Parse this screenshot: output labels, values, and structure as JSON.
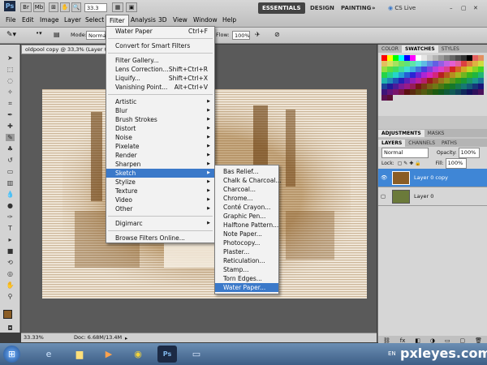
{
  "app": {
    "logo": "Ps",
    "menu": [
      "File",
      "Edit",
      "Image",
      "Layer",
      "Select",
      "Filter",
      "Analysis",
      "3D",
      "View",
      "Window",
      "Help"
    ],
    "active_menu": "Filter",
    "zoom_field": "33.3",
    "workspaces": [
      "ESSENTIALS",
      "DESIGN",
      "PAINTING"
    ],
    "more_workspaces": "»",
    "cs_live": "CS Live",
    "window_controls": [
      "–",
      "▢",
      "✕"
    ]
  },
  "options": {
    "mode_label": "Mode:",
    "mode_value": "Normal",
    "flow_label": "Flow:",
    "flow_value": "100%",
    "opacity_value": "100%"
  },
  "document": {
    "tab_title": "oldpool copy @ 33,3% (Layer 0 c",
    "status_zoom": "33.33%",
    "status_doc": "Doc: 6.68M/13.4M"
  },
  "filter_menu": {
    "items": [
      {
        "label": "Water Paper",
        "shortcut": "Ctrl+F"
      },
      {
        "sep": true
      },
      {
        "label": "Convert for Smart Filters"
      },
      {
        "sep": true
      },
      {
        "label": "Filter Gallery..."
      },
      {
        "label": "Lens Correction...",
        "shortcut": "Shift+Ctrl+R"
      },
      {
        "label": "Liquify...",
        "shortcut": "Shift+Ctrl+X"
      },
      {
        "label": "Vanishing Point...",
        "shortcut": "Alt+Ctrl+V"
      },
      {
        "sep": true
      },
      {
        "label": "Artistic",
        "sub": true
      },
      {
        "label": "Blur",
        "sub": true
      },
      {
        "label": "Brush Strokes",
        "sub": true
      },
      {
        "label": "Distort",
        "sub": true
      },
      {
        "label": "Noise",
        "sub": true
      },
      {
        "label": "Pixelate",
        "sub": true
      },
      {
        "label": "Render",
        "sub": true
      },
      {
        "label": "Sharpen",
        "sub": true
      },
      {
        "label": "Sketch",
        "sub": true,
        "highlight": true
      },
      {
        "label": "Stylize",
        "sub": true
      },
      {
        "label": "Texture",
        "sub": true
      },
      {
        "label": "Video",
        "sub": true
      },
      {
        "label": "Other",
        "sub": true
      },
      {
        "sep": true
      },
      {
        "label": "Digimarc",
        "sub": true
      },
      {
        "sep": true
      },
      {
        "label": "Browse Filters Online..."
      }
    ]
  },
  "sketch_menu": {
    "items": [
      "Bas Relief...",
      "Chalk & Charcoal...",
      "Charcoal...",
      "Chrome...",
      "Conté Crayon...",
      "Graphic Pen...",
      "Halftone Pattern...",
      "Note Paper...",
      "Photocopy...",
      "Plaster...",
      "Reticulation...",
      "Stamp...",
      "Torn Edges...",
      "Water Paper..."
    ],
    "highlight_index": 13
  },
  "panels": {
    "color_tabs": [
      "COLOR",
      "SWATCHES",
      "STYLES"
    ],
    "adj_tabs": [
      "ADJUSTMENTS",
      "MASKS"
    ],
    "layer_tabs": [
      "LAYERS",
      "CHANNELS",
      "PATHS"
    ],
    "blend_mode": "Normal",
    "opacity_label": "Opacity:",
    "opacity_value": "100%",
    "lock_label": "Lock:",
    "fill_label": "Fill:",
    "fill_value": "100%",
    "layers": [
      {
        "name": "Layer 0 copy",
        "selected": true,
        "visible": true
      },
      {
        "name": "Layer 0",
        "selected": false,
        "visible": false
      }
    ]
  },
  "colors": {
    "accent": "#3b79c9",
    "sepia": "#8a5d25",
    "foreground": "#8a5d25",
    "background": "#ffffff"
  },
  "taskbar": {
    "lang": "EN",
    "watermark": "pxleyes.com"
  }
}
